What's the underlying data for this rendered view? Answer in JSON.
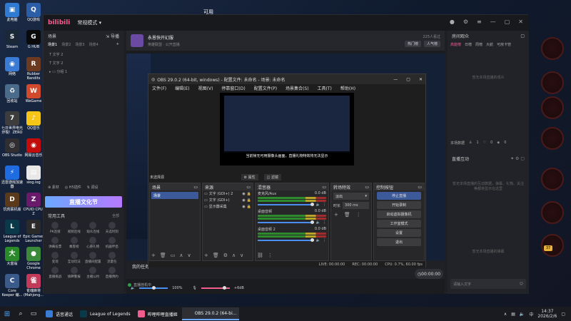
{
  "desktop": {
    "top_text": "可用",
    "icons": [
      {
        "label": "此电脑",
        "color": "#2e7bd1",
        "glyph": "▣"
      },
      {
        "label": "QQ游戏",
        "color": "#2c5ea8",
        "glyph": "Q"
      },
      {
        "label": "Steam",
        "color": "#1b2838",
        "glyph": "S"
      },
      {
        "label": "G HUB",
        "color": "#0a0a0a",
        "glyph": "G"
      },
      {
        "label": "网络",
        "color": "#3a7bd5",
        "glyph": "◉"
      },
      {
        "label": "Rubber Bandits",
        "color": "#6c3a20",
        "glyph": "R"
      },
      {
        "label": "回收站",
        "color": "#4a6b8a",
        "glyph": "♻"
      },
      {
        "label": "WeGame",
        "color": "#d14a2e",
        "glyph": "W"
      },
      {
        "label": "七日世界电光炸裂！ZERO",
        "color": "#3d3d3d",
        "glyph": "7"
      },
      {
        "label": "QQ音乐",
        "color": "#f5c518",
        "glyph": "♪"
      },
      {
        "label": "OBS Studio",
        "color": "#302e31",
        "glyph": "◎"
      },
      {
        "label": "网易云音乐",
        "color": "#c20c0c",
        "glyph": "◉"
      },
      {
        "label": "迅雷游戏加速器",
        "color": "#1e6ce0",
        "glyph": "⚡"
      },
      {
        "label": "slog.log",
        "color": "#e8e8e8",
        "glyph": "▤"
      },
      {
        "label": "饥荒联机版",
        "color": "#5a3a1a",
        "glyph": "D"
      },
      {
        "label": "CPUID CPU-Z",
        "color": "#6a1a6a",
        "glyph": "Z"
      },
      {
        "label": "League of Legends",
        "color": "#0a3a4a",
        "glyph": "L"
      },
      {
        "label": "Epic Games Launcher",
        "color": "#2a2a2a",
        "glyph": "E"
      },
      {
        "label": "大富翁",
        "color": "#2a8a2a",
        "glyph": "大"
      },
      {
        "label": "Google Chrome",
        "color": "#3a8a3a",
        "glyph": "●"
      },
      {
        "label": "Core Keeper 编...",
        "color": "#3a5a8a",
        "glyph": "C"
      },
      {
        "label": "雀魂麻将(Mahjong...",
        "color": "#c23a5a",
        "glyph": "雀"
      }
    ]
  },
  "bili": {
    "logo": "bilibili",
    "mode": "常规模式",
    "scenes_title": "场景",
    "import_label": "导播",
    "scene_tab_1": "场景1",
    "scene_tab_2": "场景2",
    "scene_tab_3": "场景3",
    "scene_tab_4": "场景4",
    "sources": [
      "文字 2",
      "文字 2"
    ],
    "group": "分组 1",
    "material_label": "素材",
    "h5_label": "H5插件",
    "adjust_label": "调设",
    "banner": "直播文化节",
    "tools_title": "常用工具",
    "tools_all": "全部",
    "tools": [
      "PK连接",
      "视频连线",
      "观众连线",
      "天选时刻",
      "弹幕投票",
      "乘客榜",
      "心愿礼物",
      "机器伴侣",
      "变现",
      "互动玩法",
      "直播间配置",
      "流量包",
      "直播挑战",
      "挑衅警报",
      "主播公约",
      "直播预约"
    ],
    "stream_title": "永恩快开幻服",
    "stream_sub": "英雄联盟",
    "stream_sub2": "公开直播",
    "fans": "225人看过",
    "hot_rank": "热门榜",
    "popularity": "人气榜",
    "my_tasks": "我的任务",
    "vol_pct": "100%",
    "mic_db": "+6dB",
    "bottom_status": "直播挂机中",
    "start_time": "00:00:00",
    "room_title": "房间观众",
    "room_tabs": [
      "高能榜",
      "日榜",
      "周榜",
      "大航",
      "可房卡管"
    ],
    "room_empty": "暂无本场直播的观众",
    "local_stats": "本场数据",
    "stat_1": "1",
    "stat_2": "0",
    "stat_3": "0",
    "interact_title": "直播互动",
    "interact_empty": "暂无本场直播的互动数据，弹幕、礼物、关注等都将显示在这里",
    "chat_empty": "暂无本场直播的弹幕",
    "chat_placeholder": "请输入文字",
    "gift_count": "37"
  },
  "obs": {
    "title": "OBS 29.0.2 (64-bit, windows) - 配置文件: 未命名 - 场景: 未命名",
    "menu": [
      "文件(F)",
      "编辑(E)",
      "视图(V)",
      "停靠窗口(D)",
      "配置文件(P)",
      "场景集合(S)",
      "工具(T)",
      "帮助(H)"
    ],
    "toast": "当前帧无可用摄像头画面，直播礼物特效将无法显示",
    "source_label": "未选择源",
    "props_btn": "属性",
    "filter_btn": "滤镜",
    "scenes_title": "场景",
    "scene_item": "场景",
    "sources_title": "来源",
    "sources": [
      "文字 (GDI+) 2",
      "文字 (GDI+)",
      "显示器采集"
    ],
    "mixer_title": "混音器",
    "mixer": [
      {
        "name": "麦克风/Aux",
        "db": "0.0 dB"
      },
      {
        "name": "桌面音频",
        "db": "0.0 dB"
      },
      {
        "name": "桌面音频 2",
        "db": "0.0 dB"
      }
    ],
    "trans_title": "转场特效",
    "trans_value": "淡出",
    "duration_label": "时长",
    "duration_value": "300 ms",
    "ctrl_title": "控制按钮",
    "ctrl_buttons": [
      "停止直播",
      "开始录制",
      "启动虚拟摄像机",
      "工作室模式",
      "设置",
      "退出"
    ],
    "status_live": "LIVE: 00:00:00",
    "status_rec": "REC: 00:00:00",
    "status_cpu": "CPU: 0.7%, 60.00 fps"
  },
  "taskbar": {
    "items": [
      {
        "label": "语音通话",
        "color": "#3a7bd5"
      },
      {
        "label": "League of Legends",
        "color": "#0a3a4a"
      },
      {
        "label": "哔哩哔哩直播姬",
        "color": "#f25d8e"
      },
      {
        "label": "OBS 29.0.2 (64-bi...",
        "color": "#302e31"
      }
    ],
    "time": "14:37",
    "date": "2026/2/6",
    "lang": "中"
  }
}
